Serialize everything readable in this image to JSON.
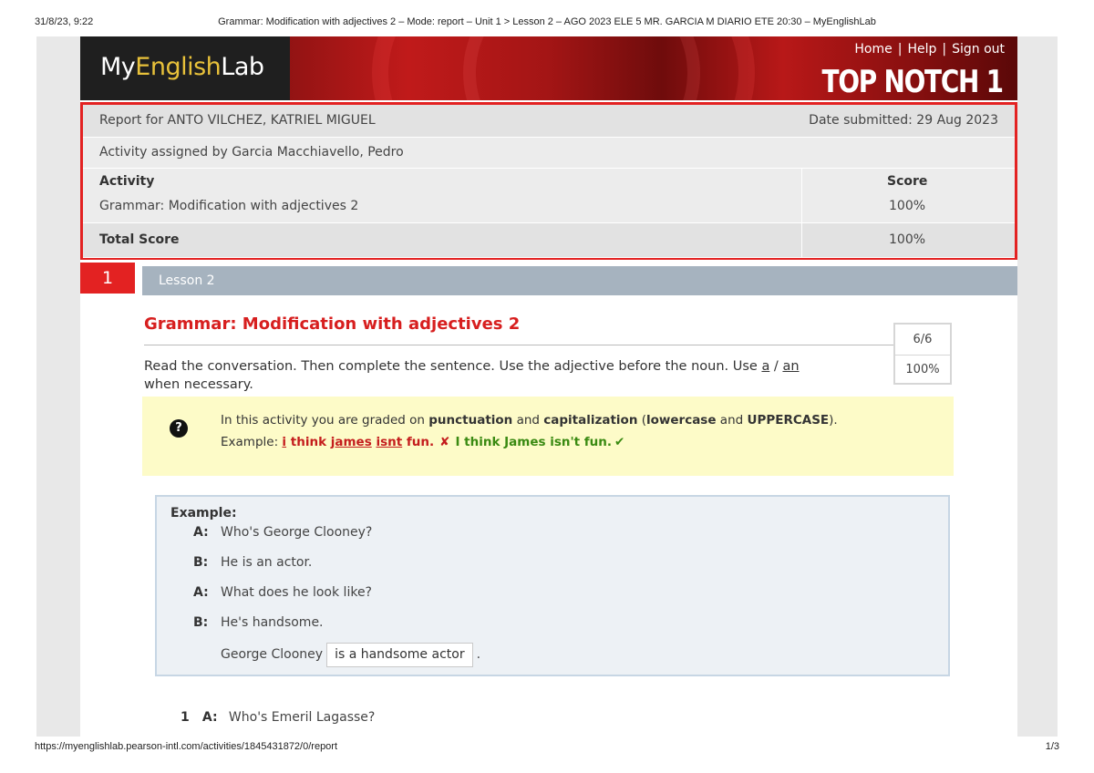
{
  "print_header": {
    "date": "31/8/23, 9:22",
    "title": "Grammar: Modification with adjectives 2 – Mode: report – Unit 1 > Lesson 2 – AGO 2023 ELE 5 MR. GARCIA M DIARIO ETE 20:30 – MyEnglishLab"
  },
  "print_footer": {
    "url": "https://myenglishlab.pearson-intl.com/activities/1845431872/0/report",
    "page": "1/3"
  },
  "banner": {
    "logo_my": "My",
    "logo_english": "English",
    "logo_lab": "Lab",
    "nav": [
      "Home",
      "Help",
      "Sign out"
    ],
    "nav_separator": "|",
    "course_title": "TOP NOTCH 1"
  },
  "report": {
    "report_for": "Report for ANTO VILCHEZ, KATRIEL MIGUEL",
    "date_submitted": "Date submitted: 29 Aug 2023",
    "assigned_by": "Activity assigned by Garcia Macchiavello, Pedro",
    "activity_header": "Activity",
    "score_header": "Score",
    "activity_name": "Grammar: Modification with adjectives 2",
    "activity_score": "100%",
    "total_label": "Total Score",
    "total_score": "100%"
  },
  "question": {
    "number": "1",
    "lesson": "Lesson 2",
    "title": "Grammar: Modification with adjectives 2",
    "score_fraction": "6/6",
    "score_percent": "100%",
    "instructions_pre": "Read the conversation. Then complete the sentence. Use the adjective before the noun. Use ",
    "instructions_a": "a",
    "instructions_slash": " / ",
    "instructions_an": "an",
    "instructions_post": " when necessary."
  },
  "note": {
    "help_icon": "?",
    "line1_pre": "In this activity you are graded on ",
    "punctuation": "punctuation",
    "and1": " and ",
    "capitalization": "capitalization",
    "paren_open": " (",
    "lowercase": "lowercase",
    "and2": " and ",
    "uppercase": "UPPERCASE",
    "paren_close": ").",
    "example_label": "Example: ",
    "wrong_i": "i",
    "wrong_think": " think ",
    "wrong_james": "james",
    "wrong_space": " ",
    "wrong_isnt": "isnt",
    "wrong_fun": " fun.",
    "x_icon": "✘",
    "right_text": "I think James isn't fun.",
    "check_icon": "✔"
  },
  "example": {
    "heading": "Example:",
    "lines": [
      {
        "speaker": "A:",
        "text": "Who's George Clooney?"
      },
      {
        "speaker": "B:",
        "text": "He is an actor."
      },
      {
        "speaker": "A:",
        "text": "What does he look like?"
      },
      {
        "speaker": "B:",
        "text": "He's handsome."
      }
    ],
    "answer_prefix": "George Clooney",
    "answer_value": "is a handsome actor",
    "answer_suffix": "."
  },
  "q1": {
    "number": "1",
    "speaker": "A:",
    "text": "Who's Emeril Lagasse?"
  }
}
